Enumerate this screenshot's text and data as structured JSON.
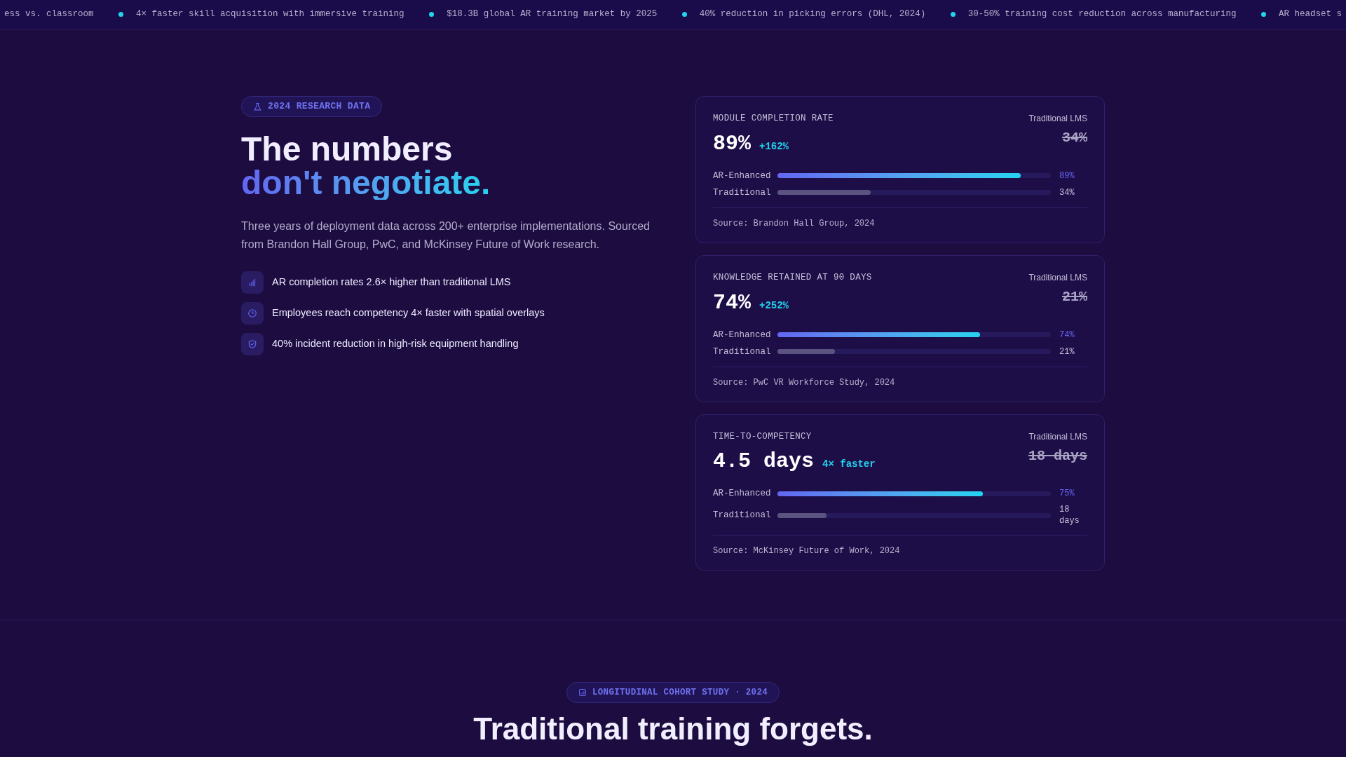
{
  "ticker": [
    "ess vs. classroom",
    "4× faster skill acquisition with immersive training",
    "$18.3B global AR training market by 2025",
    "40% reduction in picking errors (DHL, 2024)",
    "30-50% training cost reduction across manufacturing",
    "AR headset s"
  ],
  "hero": {
    "badge": "2024 RESEARCH DATA",
    "title_line_1": "The numbers",
    "title_line_2": "don't negotiate.",
    "description": "Three years of deployment data across 200+ enterprise implementations. Sourced from Brandon Hall Group, PwC, and McKinsey Future of Work research.",
    "highlights": [
      {
        "kind": "chart",
        "text": "AR completion rates 2.6× higher than traditional LMS"
      },
      {
        "kind": "clock",
        "text": "Employees reach competency 4× faster with spatial overlays"
      },
      {
        "kind": "shield",
        "text": "40% incident reduction in high-risk equipment handling"
      }
    ]
  },
  "metrics": [
    {
      "title": "MODULE COMPLETION RATE",
      "value": "89%",
      "delta": "+162%",
      "compare_label": "Traditional LMS",
      "compare_value": "34%",
      "bars": [
        {
          "kind": "enhanced",
          "label": "AR-Enhanced",
          "level": 0.89,
          "reading": "89%"
        },
        {
          "kind": "traditional",
          "label": "Traditional",
          "level": 0.34,
          "reading": "34%"
        }
      ],
      "source": "Source: Brandon Hall Group, 2024"
    },
    {
      "title": "KNOWLEDGE RETAINED AT 90 DAYS",
      "value": "74%",
      "delta": "+252%",
      "compare_label": "Traditional LMS",
      "compare_value": "21%",
      "bars": [
        {
          "kind": "enhanced",
          "label": "AR-Enhanced",
          "level": 0.74,
          "reading": "74%"
        },
        {
          "kind": "traditional",
          "label": "Traditional",
          "level": 0.21,
          "reading": "21%"
        }
      ],
      "source": "Source: PwC VR Workforce Study, 2024"
    },
    {
      "title": "TIME-TO-COMPETENCY",
      "value": "4.5 days",
      "delta": "4× faster",
      "compare_label": "Traditional LMS",
      "compare_value": "18 days",
      "bars": [
        {
          "kind": "enhanced",
          "label": "AR-Enhanced",
          "level": 0.75,
          "reading": "75%"
        },
        {
          "kind": "traditional",
          "label": "Traditional",
          "level": 0.18,
          "reading": "18 days"
        }
      ],
      "source": "Source: McKinsey Future of Work, 2024"
    }
  ],
  "cohort": {
    "badge": "LONGITUDINAL COHORT STUDY · 2024",
    "title": "Traditional training forgets."
  }
}
